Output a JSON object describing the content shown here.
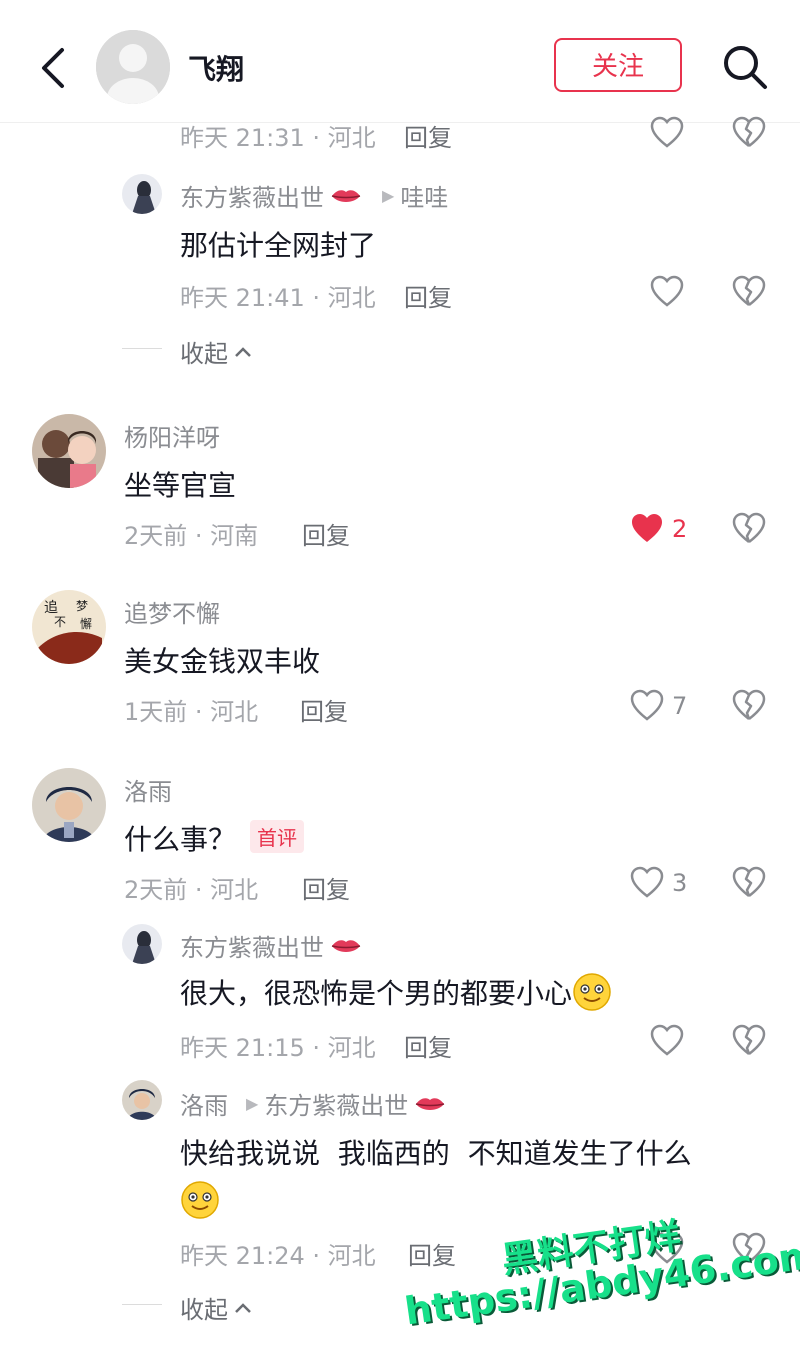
{
  "header": {
    "username": "飞翔",
    "follow_label": "关注"
  },
  "comments": {
    "top_reply_meta": "昨天 21:31 · 河北",
    "reply_label": "回复",
    "reply1": {
      "name": "东方紫薇出世",
      "reply_to": "哇哇",
      "text": "那估计全网封了",
      "meta": "昨天 21:41 · 河北"
    },
    "collapse1": "收起",
    "c1": {
      "name": "杨阳洋呀",
      "text": "坐等官宣",
      "meta": "2天前 · 河南",
      "likes": "2"
    },
    "c2": {
      "name": "追梦不懈",
      "text": "美女金钱双丰收",
      "meta": "1天前 · 河北",
      "likes": "7",
      "avatar_text": "追梦不懈"
    },
    "c3": {
      "name": "洛雨",
      "text": "什么事？",
      "tag": "首评",
      "meta": "2天前 · 河北",
      "likes": "3"
    },
    "reply2": {
      "name": "东方紫薇出世",
      "text": "很大，很恐怖是个男的都要小心",
      "meta": "昨天 21:15 · 河北"
    },
    "reply3": {
      "name": "洛雨",
      "reply_to": "东方紫薇出世",
      "text": "快给我说说  我临西的  不知道发生了什么",
      "meta": "昨天 21:24 · 河北"
    },
    "collapse2": "收起"
  },
  "watermark": {
    "line1": "黑料不打烊",
    "line2": "https://abdy46.com"
  },
  "colors": {
    "accent": "#e8334d",
    "watermark": "#17e08a"
  }
}
